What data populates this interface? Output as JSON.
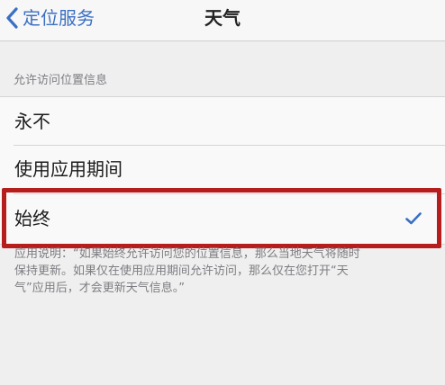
{
  "nav": {
    "back_label": "定位服务",
    "title": "天气"
  },
  "section": {
    "header": "允许访问位置信息"
  },
  "options": [
    {
      "label": "永不",
      "selected": false
    },
    {
      "label": "使用应用期间",
      "selected": false
    },
    {
      "label": "始终",
      "selected": true
    }
  ],
  "footer": {
    "line1": "应用说明：“如果始终允许访问您的位置信息，那么当地天气将随时",
    "line2": "保持更新。如果仅在使用应用期间允许访问，那么仅在您打开“天",
    "line3": "气”应用后，才会更新天气信息。”"
  },
  "colors": {
    "accent": "#3a6fc3",
    "highlight_frame": "#b61d1d",
    "background": "#efefef"
  },
  "icons": {
    "back": "chevron-left-icon",
    "selected": "checkmark-icon"
  }
}
